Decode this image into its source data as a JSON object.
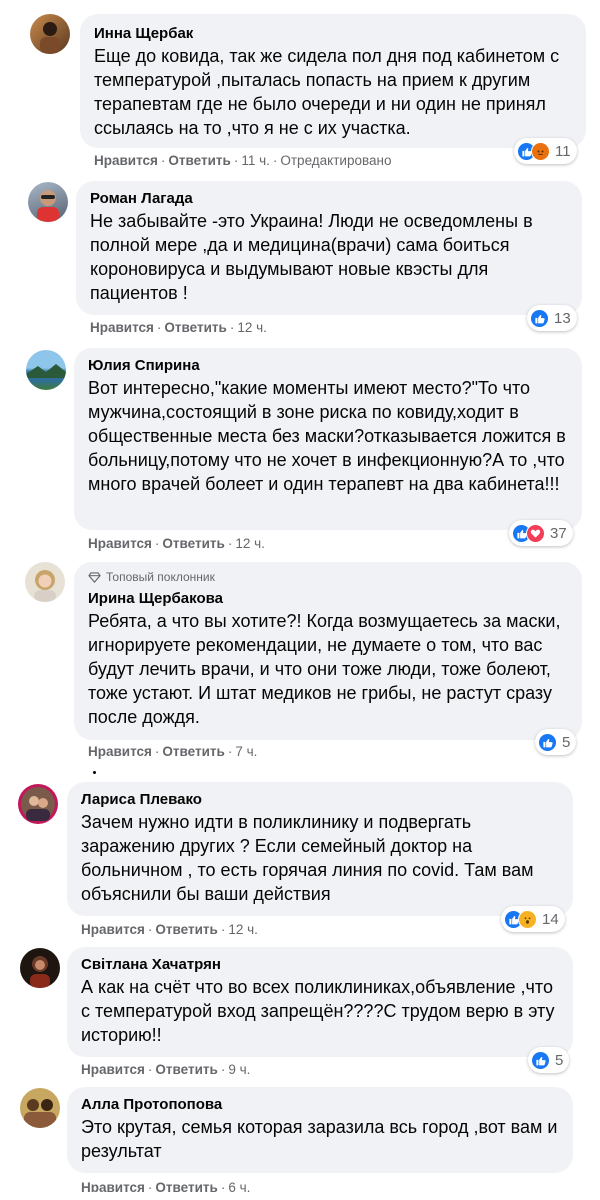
{
  "actions": {
    "like": "Нравится",
    "reply": "Ответить"
  },
  "comments": [
    {
      "author": "Инна Щербак",
      "text": "Еще до ковида, так же сидела пол дня под кабинетом с температурой ,пыталась попасть на прием к другим терапевтам где не было очереди и ни один не принял ссылаясь на то ,что я не с их участка.",
      "time": "11 ч.",
      "edited": "Отредактировано",
      "reaction_count": "11",
      "reaction_icons": [
        "like-reaction-icon",
        "angry-reaction-icon"
      ],
      "avatar_color": "#a0522d"
    },
    {
      "author": "Роман Лагада",
      "text": "Не забывайте -это Украина! Люди не осведомлены в полной мере ,да и медицина(врачи) сама боиться короновируса и выдумывают новые квэсты для пациентов !",
      "time": "12 ч.",
      "reaction_count": "13",
      "reaction_icons": [
        "like-reaction-icon"
      ],
      "avatar_color": "#6b7a8f"
    },
    {
      "author": "Юлия Спирина",
      "text": "Вот интересно,\"какие моменты имеют место?\"То что мужчина,состоящий в зоне риска по ковиду,ходит в общественные места без маски?отказывается ложится в больницу,потому что не хочет в инфекционную?А то ,что много врачей болеет и один терапевт на два кабинета!!!",
      "time": "12 ч.",
      "reaction_count": "37",
      "reaction_icons": [
        "like-reaction-icon",
        "love-reaction-icon"
      ],
      "avatar_color": "#4a90c2"
    },
    {
      "author": "Ирина Щербакова",
      "badge": "Топовый поклонник",
      "text": "Ребята, а что вы хотите?! Когда возмущаетесь за маски, игнорируете рекомендации, не думаете о том, что вас будут лечить врачи, и что они тоже люди, тоже болеют, тоже устают. И штат медиков не грибы, не растут сразу после дождя.",
      "time": "7 ч.",
      "reaction_count": "5",
      "reaction_icons": [
        "like-reaction-icon"
      ],
      "avatar_color": "#d9c7a8"
    },
    {
      "author": "Лариса Плевако",
      "text": "Зачем нужно идти в поликлинику и подвергать заражению других ? Если семейный доктор на больничном , то есть горячая линия по covid. Там вам объяснили бы ваши действия",
      "time": "12 ч.",
      "reaction_count": "14",
      "reaction_icons": [
        "like-reaction-icon",
        "wow-reaction-icon"
      ],
      "avatar_color": "#c2185b"
    },
    {
      "author": "Світлана Хачатрян",
      "text": "А как на счёт что во всех поликлиниках,объявление ,что с температурой вход запрещён????С трудом верю в эту историю!!",
      "time": "9 ч.",
      "reaction_count": "5",
      "reaction_icons": [
        "like-reaction-icon"
      ],
      "avatar_color": "#3a2a20"
    },
    {
      "author": "Алла Протопопова",
      "text": "Это крутая, семья которая заразила всь город ,вот вам и результат",
      "time": "6 ч.",
      "avatar_color": "#8a6a3a"
    }
  ]
}
